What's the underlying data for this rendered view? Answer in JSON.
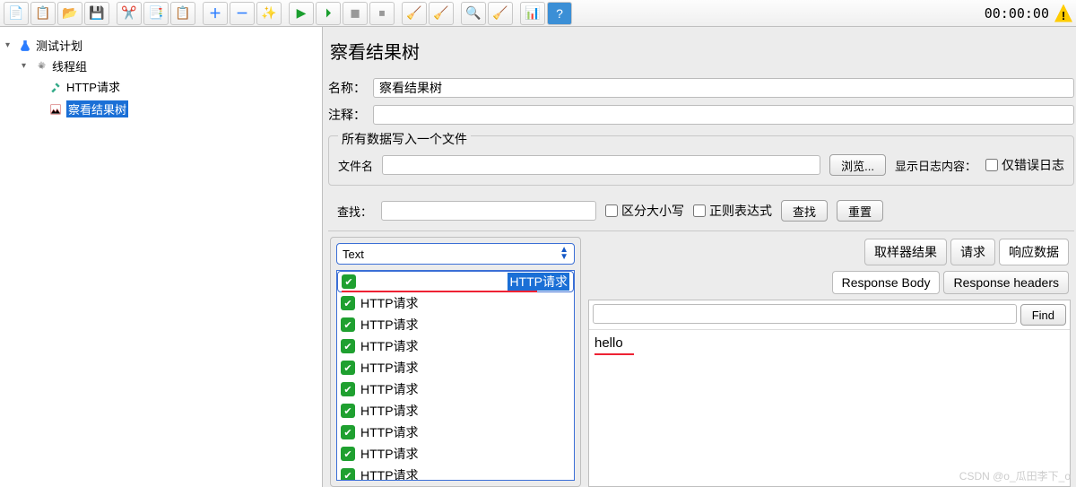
{
  "toolbar": {
    "time": "00:00:00",
    "icons": [
      "file",
      "open",
      "folder",
      "save",
      "",
      "cut",
      "copy",
      "paste",
      "",
      "plus",
      "minus",
      "wand",
      "",
      "run",
      "runtime",
      "stop1",
      "stop2",
      "",
      "broom1",
      "broom2",
      "",
      "binoc",
      "sweep",
      "",
      "list",
      "help"
    ]
  },
  "tree": {
    "root": {
      "label": "测试计划",
      "expanded": true
    },
    "group": {
      "label": "线程组",
      "expanded": true
    },
    "http": {
      "label": "HTTP请求"
    },
    "results": {
      "label": "察看结果树",
      "selected": true
    }
  },
  "panel": {
    "title": "察看结果树",
    "name_label": "名称：",
    "name_value": "察看结果树",
    "comment_label": "注释：",
    "comment_value": ""
  },
  "file_fieldset": {
    "legend": "所有数据写入一个文件",
    "filename_label": "文件名",
    "filename_value": "",
    "browse": "浏览...",
    "display_label": "显示日志内容：",
    "only_errors": "仅错误日志"
  },
  "search": {
    "label": "查找：",
    "value": "",
    "case_sensitive": "区分大小写",
    "regex": "正则表达式",
    "find_btn": "查找",
    "reset_btn": "重置"
  },
  "results": {
    "renderer": "Text",
    "items": [
      "HTTP请求",
      "HTTP请求",
      "HTTP请求",
      "HTTP请求",
      "HTTP请求",
      "HTTP请求",
      "HTTP请求",
      "HTTP请求",
      "HTTP请求",
      "HTTP请求"
    ]
  },
  "tabs": {
    "sampler": "取样器结果",
    "request": "请求",
    "response": "响应数据",
    "body": "Response Body",
    "headers": "Response headers",
    "find": "Find"
  },
  "response": {
    "body": "hello"
  },
  "watermark": "CSDN @o_瓜田李下_o"
}
